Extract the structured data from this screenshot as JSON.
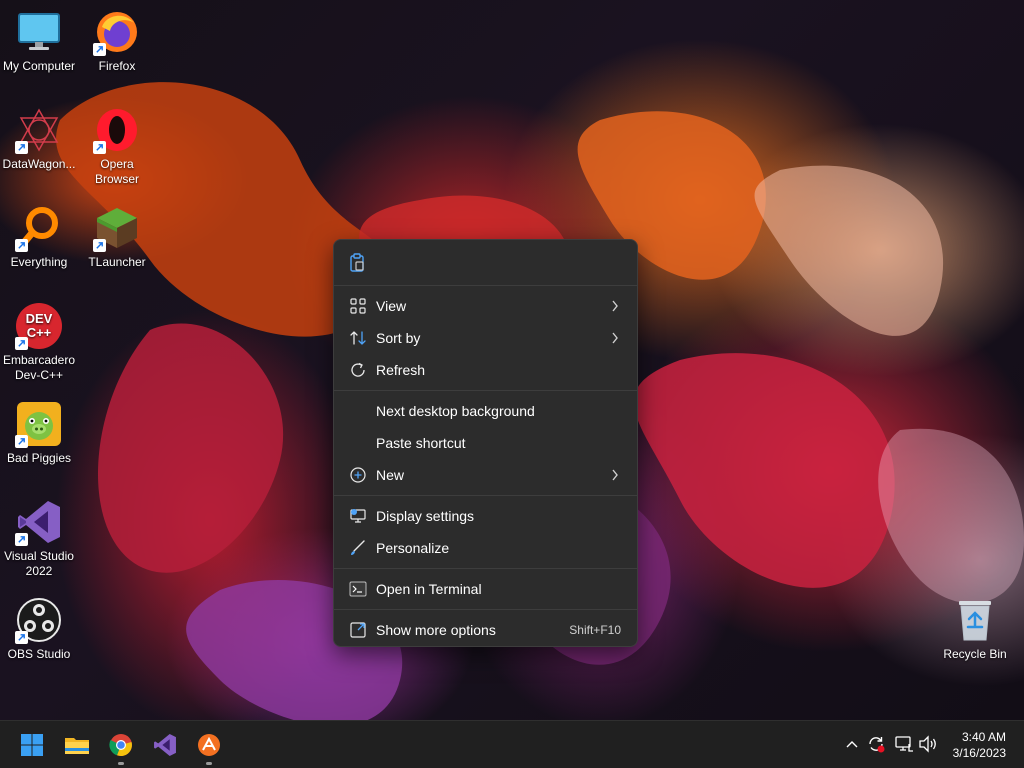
{
  "desktop": {
    "icons": [
      {
        "label": "My Computer",
        "icon": "monitor-icon",
        "shortcut": false
      },
      {
        "label": "Firefox",
        "icon": "firefox-icon",
        "shortcut": true
      },
      {
        "label": "DataWagon...",
        "icon": "datawagon-icon",
        "shortcut": true
      },
      {
        "label": "Opera Browser",
        "icon": "opera-icon",
        "shortcut": true
      },
      {
        "label": "Everything",
        "icon": "everything-search-icon",
        "shortcut": true
      },
      {
        "label": "TLauncher",
        "icon": "tlauncher-grass-block-icon",
        "shortcut": true
      },
      {
        "label": "Embarcadero Dev-C++",
        "icon": "devcpp-icon",
        "shortcut": true
      },
      {
        "label": "Bad Piggies",
        "icon": "bad-piggies-icon",
        "shortcut": true
      },
      {
        "label": "Visual Studio 2022",
        "icon": "visual-studio-icon",
        "shortcut": true
      },
      {
        "label": "OBS Studio",
        "icon": "obs-icon",
        "shortcut": true
      },
      {
        "label": "Recycle Bin",
        "icon": "recycle-bin-icon",
        "shortcut": false
      }
    ],
    "devcpp_badge_text": "DEV C++"
  },
  "context_menu": {
    "top_icons": [
      "paste-icon"
    ],
    "items": [
      {
        "label": "View",
        "icon": "view-grid-icon",
        "submenu": true
      },
      {
        "label": "Sort by",
        "icon": "sort-icon",
        "submenu": true
      },
      {
        "label": "Refresh",
        "icon": "refresh-icon",
        "submenu": false
      },
      {
        "label": "Next desktop background",
        "icon": "",
        "submenu": false
      },
      {
        "label": "Paste shortcut",
        "icon": "",
        "submenu": false
      },
      {
        "label": "New",
        "icon": "new-plus-icon",
        "submenu": true
      },
      {
        "label": "Display settings",
        "icon": "display-settings-icon",
        "submenu": false
      },
      {
        "label": "Personalize",
        "icon": "personalize-brush-icon",
        "submenu": false
      },
      {
        "label": "Open in Terminal",
        "icon": "terminal-icon",
        "submenu": false
      },
      {
        "label": "Show more options",
        "icon": "show-more-options-icon",
        "submenu": false,
        "shortcut": "Shift+F10"
      }
    ]
  },
  "taskbar": {
    "apps": [
      "start-icon",
      "file-explorer-icon",
      "chrome-icon",
      "visual-studio-icon",
      "app-icon"
    ],
    "tray": [
      "chevron-up-icon",
      "sync-icon",
      "network-icon",
      "volume-icon"
    ],
    "clock": {
      "time": "3:40 AM",
      "date": "3/16/2023"
    }
  },
  "colors": {
    "menu_bg": "#2c2c2c",
    "taskbar_bg": "#202020",
    "windows_blue": "#3aa0f3"
  }
}
